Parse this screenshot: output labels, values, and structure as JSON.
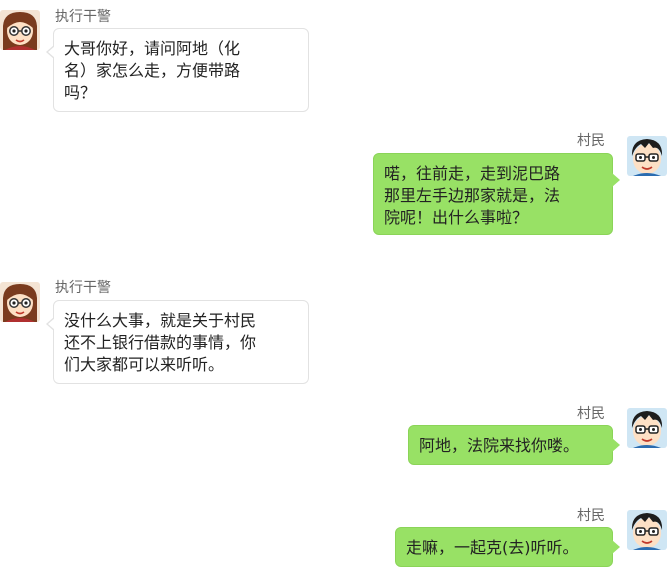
{
  "chat": {
    "officer_name": "执行干警",
    "villager_name": "村民",
    "colors": {
      "outgoing_bubble": "#98e165",
      "incoming_bubble": "#ffffff",
      "name_text": "#666666"
    },
    "messages": [
      {
        "sender": "执行干警",
        "side": "left",
        "avatar": "girl-with-glasses-avatar",
        "text": "大哥你好，请问阿地（化\n名）家怎么走，方便带路\n吗？"
      },
      {
        "sender": "村民",
        "side": "right",
        "avatar": "boy-with-glasses-avatar",
        "text": "喏，往前走，走到泥巴路\n那里左手边那家就是，法\n院呢！出什么事啦？"
      },
      {
        "sender": "执行干警",
        "side": "left",
        "avatar": "girl-with-glasses-avatar",
        "text": "没什么大事，就是关于村民\n还不上银行借款的事情，你\n们大家都可以来听听。"
      },
      {
        "sender": "村民",
        "side": "right",
        "avatar": "boy-with-glasses-avatar",
        "text": "阿地，法院来找你喽。"
      },
      {
        "sender": "村民",
        "side": "right",
        "avatar": "boy-with-glasses-avatar",
        "text": "走嘛，一起克(去)听听。"
      }
    ]
  }
}
